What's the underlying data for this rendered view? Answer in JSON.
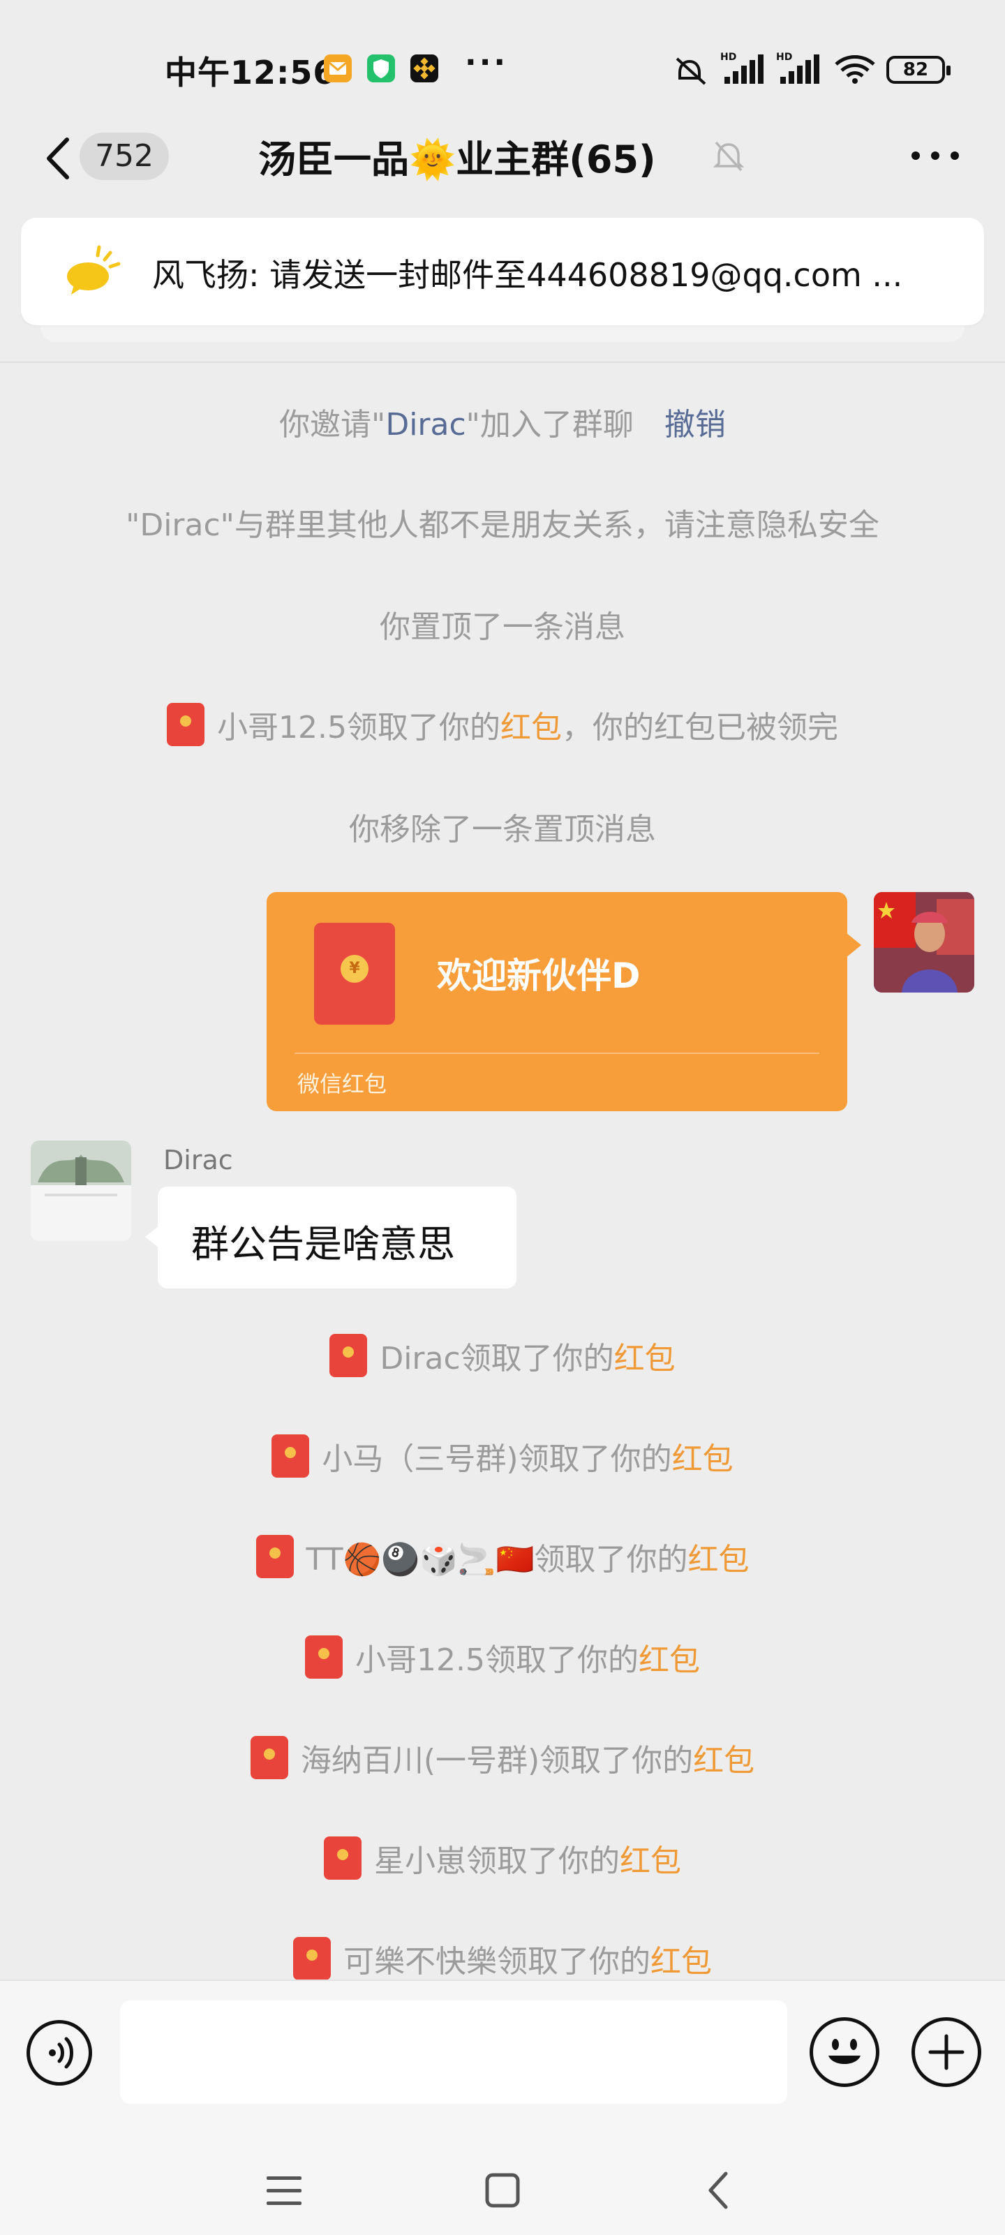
{
  "status_bar": {
    "time": "中午12:56",
    "more": "···",
    "battery": "82"
  },
  "header": {
    "unread_count": "752",
    "title": "汤臣一品🌞业主群(65)"
  },
  "pinned": {
    "text": "风飞扬: 请发送一封邮件至444608819@qq.com ..."
  },
  "system_messages": {
    "invite_prefix": "你邀请\"",
    "invite_name": "Dirac",
    "invite_suffix": "\"加入了群聊",
    "revoke": "撤销",
    "privacy": "\"Dirac\"与群里其他人都不是朋友关系，请注意隐私安全",
    "pinned_msg": "你置顶了一条消息",
    "claim1_prefix": "小哥12.5领取了你的",
    "red_packet_word": "红包",
    "claim1_suffix": "，你的红包已被领完",
    "unpinned_msg": "你移除了一条置顶消息"
  },
  "red_packet": {
    "coin": "¥",
    "greeting": "欢迎新伙伴D",
    "label": "微信红包"
  },
  "dirac_message": {
    "sender": "Dirac",
    "text": "群公告是啥意思"
  },
  "claims": [
    {
      "name": "Dirac",
      "middle": "领取了你的",
      "rp": "红包"
    },
    {
      "name": "小马（三号群)",
      "middle": "领取了你的",
      "rp": "红包"
    },
    {
      "name": "TT🏀🎱🎲🚬🇨🇳",
      "middle": "领取了你的",
      "rp": "红包"
    },
    {
      "name": "小哥12.5",
      "middle": "领取了你的",
      "rp": "红包"
    },
    {
      "name": "海纳百川(一号群)",
      "middle": "领取了你的",
      "rp": "红包"
    },
    {
      "name": "星小崽",
      "middle": "领取了你的",
      "rp": "红包"
    },
    {
      "name": "可樂不快樂",
      "middle": "领取了你的",
      "rp": "红包"
    }
  ],
  "colors": {
    "background": "#ededed",
    "red_packet": "#f79d39",
    "link_blue": "#576b95",
    "red_packet_text": "#f09a37"
  }
}
